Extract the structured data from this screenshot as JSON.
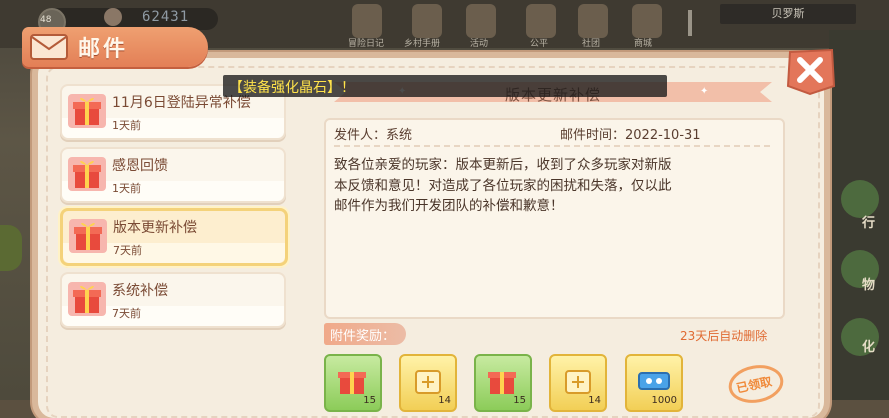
{
  "hud": {
    "level": "48",
    "coins": "62431",
    "player_name": "贝罗斯",
    "top_labels": [
      "冒险日记",
      "乡村手册",
      "活动",
      "公平",
      "社团",
      "商城"
    ],
    "right_labels": [
      "行",
      "物",
      "化"
    ]
  },
  "panel": {
    "title": "邮件",
    "close_icon": "close-x-icon",
    "accent_color": "#e37f56"
  },
  "toast": {
    "text": "【装备强化晶石】！"
  },
  "mail_list": [
    {
      "title": "11月6日登陆异常补偿",
      "time": "1天前",
      "icon": "gift-icon",
      "active": false
    },
    {
      "title": "感恩回馈",
      "time": "1天前",
      "icon": "gift-icon",
      "active": false
    },
    {
      "title": "版本更新补偿",
      "time": "7天前",
      "icon": "gift-icon",
      "active": true
    },
    {
      "title": "系统补偿",
      "time": "7天前",
      "icon": "gift-icon",
      "active": false
    }
  ],
  "mail_detail": {
    "header": "版本更新补偿",
    "sender": "发件人：系统",
    "send_time": "邮件时间：2022-10-31",
    "body_lines": [
      "致各位亲爱的玩家：版本更新后，收到了众多玩家对新版",
      "本反馈和意见！对造成了各位玩家的困扰和失落，仅以此",
      "邮件作为我们开发团队的补偿和歉意！"
    ],
    "attachments_label": "附件奖励：",
    "auto_delete": "23天后自动删除",
    "attachments": [
      {
        "icon": "gift-box-icon",
        "rarity": "green",
        "count": "15"
      },
      {
        "icon": "scroll-icon",
        "rarity": "gold",
        "count": "14"
      },
      {
        "icon": "gift-box-icon",
        "rarity": "green",
        "count": "15"
      },
      {
        "icon": "scroll-icon",
        "rarity": "gold",
        "count": "14"
      },
      {
        "icon": "ticket-icon",
        "rarity": "gold",
        "count": "1000"
      }
    ],
    "claimed_stamp": "已领取"
  }
}
